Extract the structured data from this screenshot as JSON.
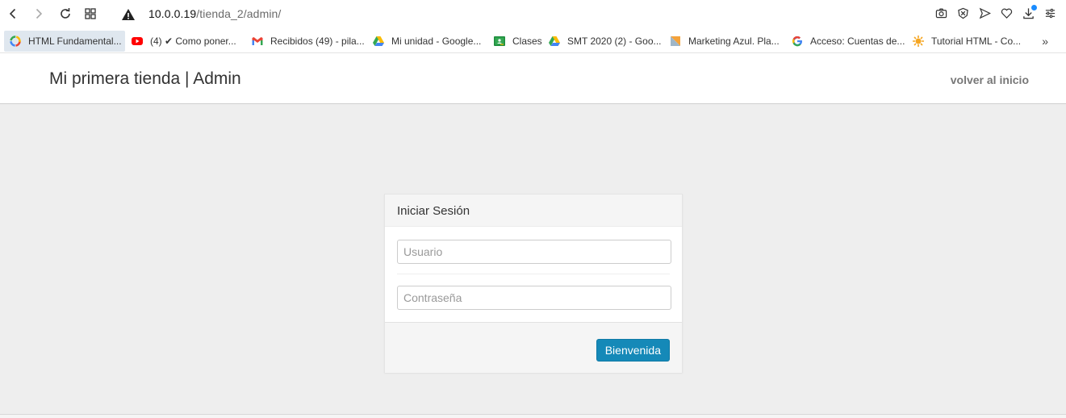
{
  "browser": {
    "url_host": "10.0.0.19",
    "url_path": "/tienda_2/admin/"
  },
  "bookmarks": [
    {
      "label": "HTML Fundamental...",
      "icon": "colorful-ring-icon"
    },
    {
      "label": "(4) ✔ Como poner...",
      "icon": "youtube-icon"
    },
    {
      "label": "Recibidos (49) - pila...",
      "icon": "gmail-icon"
    },
    {
      "label": "Mi unidad - Google...",
      "icon": "google-drive-icon"
    },
    {
      "label": "Clases",
      "icon": "classroom-icon"
    },
    {
      "label": "SMT 2020 (2) - Goo...",
      "icon": "google-drive-icon"
    },
    {
      "label": "Marketing Azul. Pla...",
      "icon": "doc-icon"
    },
    {
      "label": "Acceso: Cuentas de...",
      "icon": "google-icon"
    },
    {
      "label": "Tutorial HTML - Co...",
      "icon": "sun-icon"
    }
  ],
  "bookmarks_more": "»",
  "header": {
    "brand": "Mi primera tienda | Admin",
    "back_link": "volver al inicio"
  },
  "login": {
    "title": "Iniciar Sesión",
    "user_placeholder": "Usuario",
    "password_placeholder": "Contraseña",
    "submit_label": "Bienvenida"
  },
  "colors": {
    "primary_button": "#1589b8",
    "page_background": "#eeeeee"
  }
}
